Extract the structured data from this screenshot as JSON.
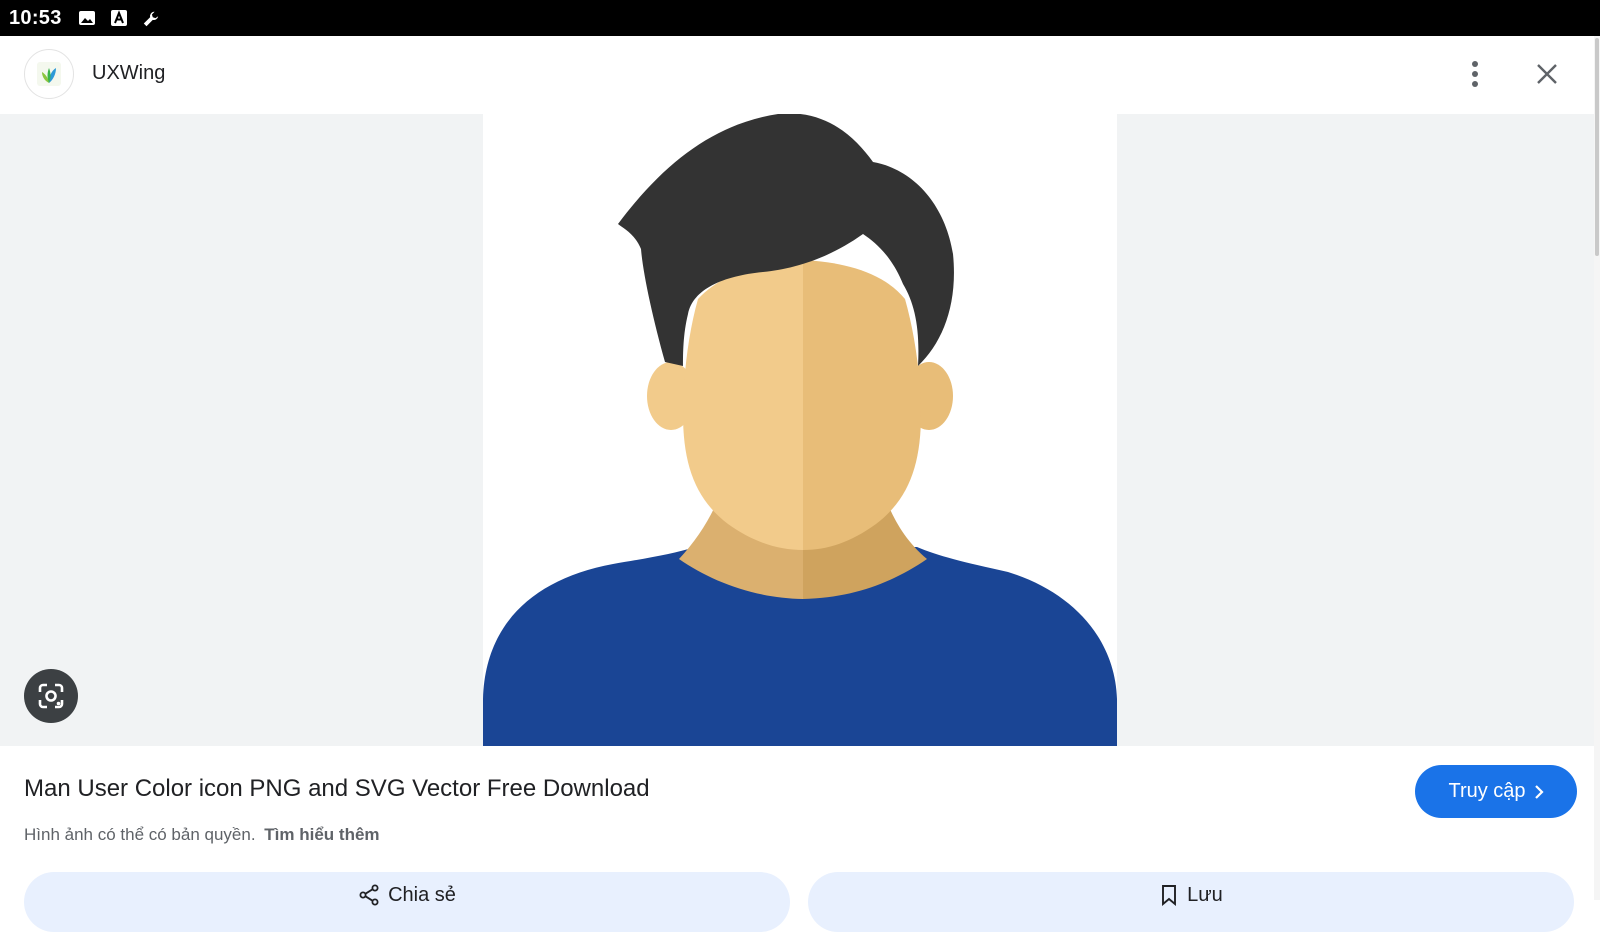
{
  "status_bar": {
    "time": "10:53",
    "icons": [
      "image-icon",
      "a-icon",
      "wrench-icon"
    ]
  },
  "header": {
    "site_name": "UXWing",
    "logo_icon": "uxwing-logo-icon",
    "more_icon": "more-vert-icon",
    "close_icon": "close-icon"
  },
  "image": {
    "subject": "man-user-color-icon",
    "colors": {
      "hair": "#333333",
      "skin_light": "#f2cb8b",
      "skin_dark": "#e8bd78",
      "neck_light": "#dbb06f",
      "neck_dark": "#cfa35e",
      "shirt": "#1a4595"
    },
    "lens_icon": "google-lens-icon"
  },
  "info": {
    "title": "Man User Color icon PNG and SVG Vector Free Download",
    "copyright_text": "Hình ảnh có thể có bản quyền.",
    "learn_more": "Tìm hiểu thêm",
    "visit_label": "Truy cập"
  },
  "actions": {
    "share_label": "Chia sẻ",
    "save_label": "Lưu"
  },
  "colors": {
    "accent": "#1a73e8",
    "action_bg": "#e8f0fe",
    "image_area_bg": "#f1f3f4"
  }
}
